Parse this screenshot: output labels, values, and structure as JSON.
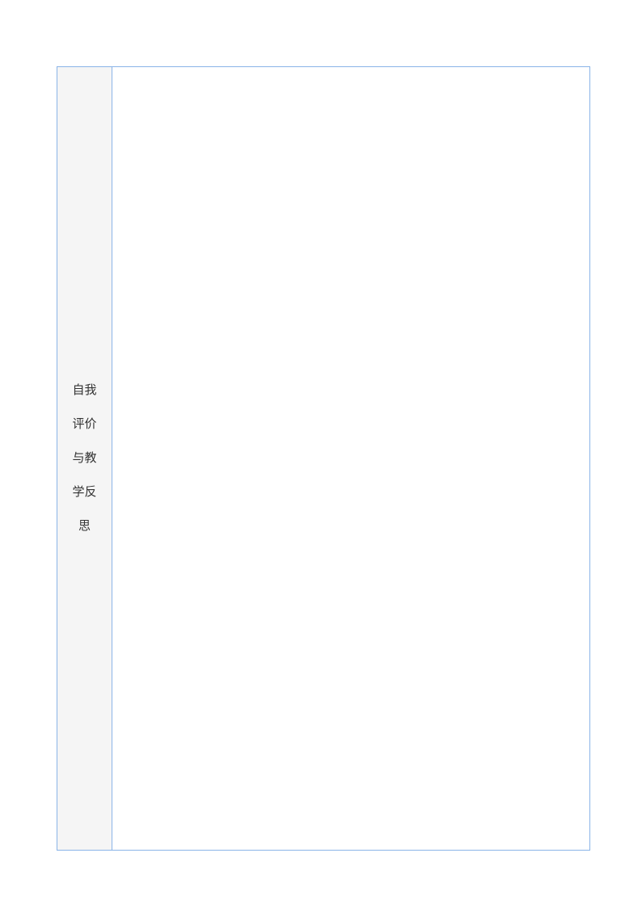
{
  "table": {
    "left_label": "自我评价与教学反思"
  }
}
